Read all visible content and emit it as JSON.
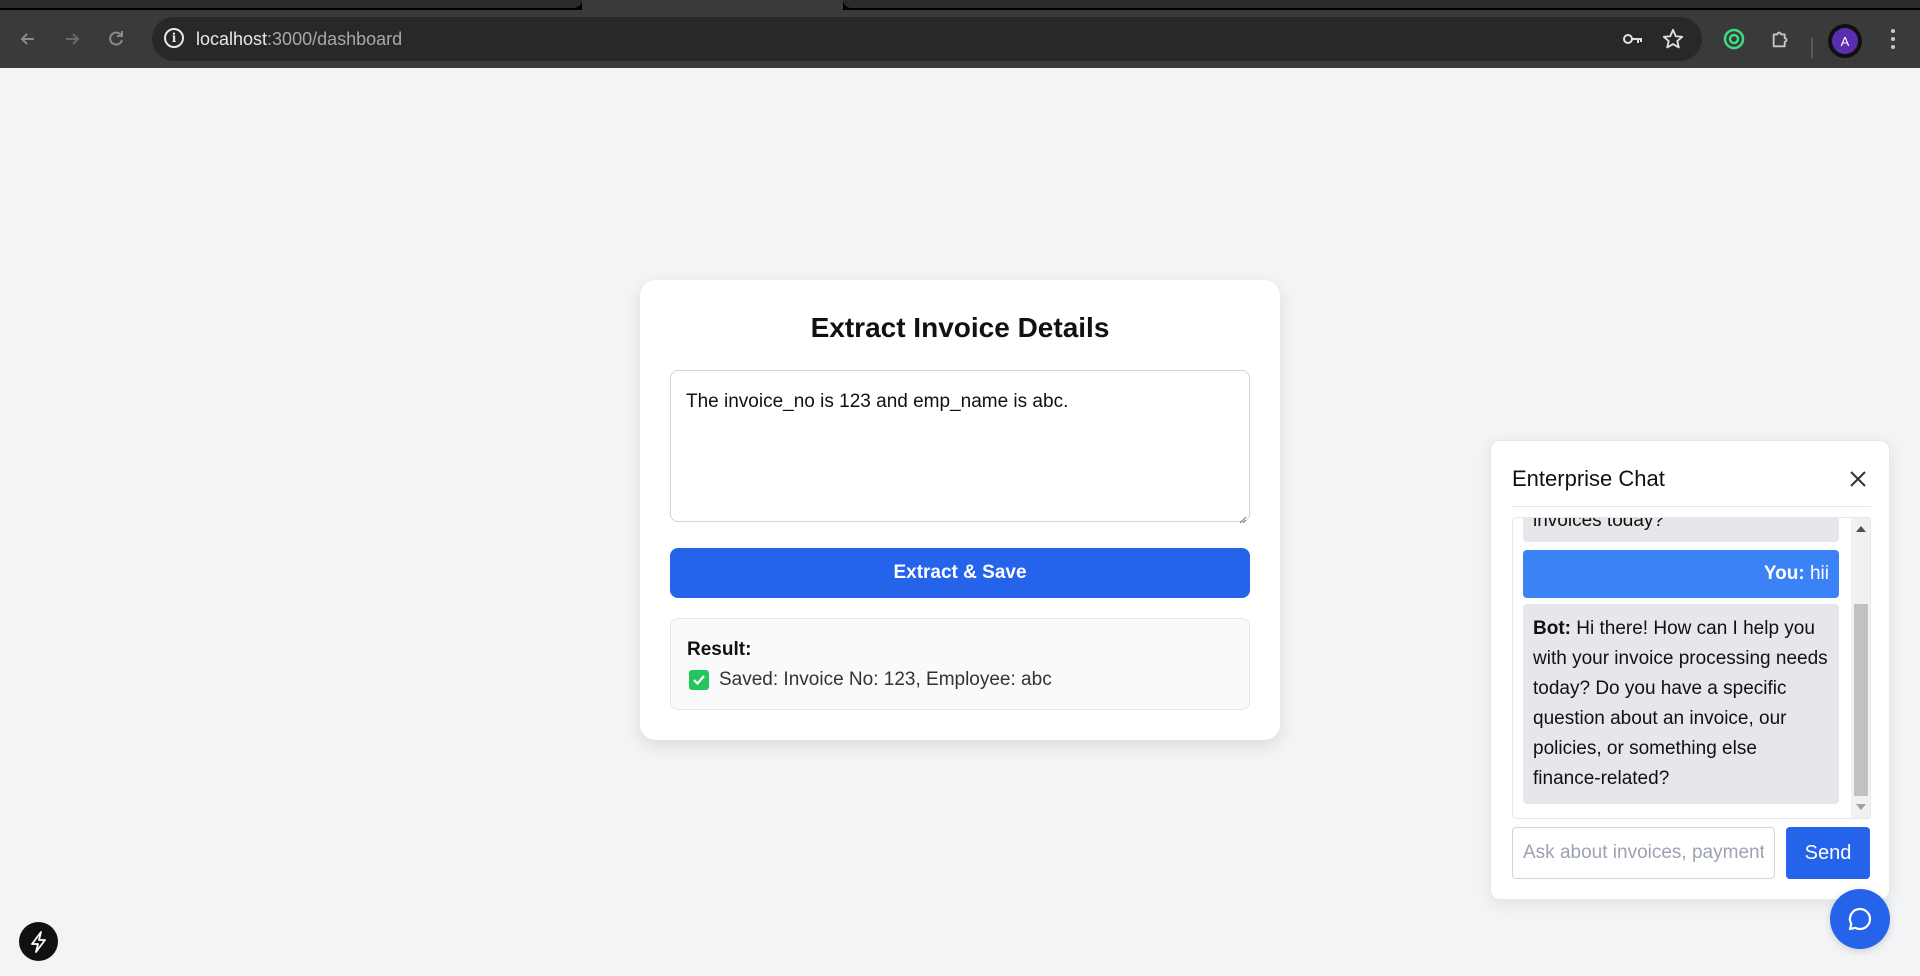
{
  "browser": {
    "url_host": "localhost",
    "url_path": ":3000/dashboard",
    "avatar_letter": "A"
  },
  "card": {
    "title": "Extract Invoice Details",
    "textarea_value": "The invoice_no is 123 and emp_name is abc.",
    "button_label": "Extract & Save",
    "result_label": "Result:",
    "result_text": "Saved: Invoice No: 123, Employee: abc"
  },
  "chat": {
    "title": "Enterprise Chat",
    "prev_bot_tail": "invoices today?",
    "user_prefix": "You:",
    "user_text": " hii",
    "bot_prefix": "Bot:",
    "bot_text": " Hi there! How can I help you with your invoice processing needs today? Do you have a specific question about an invoice, our policies, or something else finance-related?",
    "input_placeholder": "Ask about invoices, payments...",
    "send_label": "Send"
  },
  "colors": {
    "primary": "#2563eb",
    "user_bubble": "#3b82f6",
    "bot_bubble": "#e5e7eb",
    "success": "#22c55e",
    "page_bg": "#f3f4f6"
  }
}
